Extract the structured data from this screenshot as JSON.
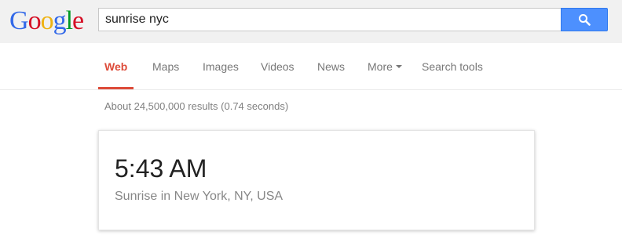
{
  "logo": {
    "letters": [
      "G",
      "o",
      "o",
      "g",
      "l",
      "e"
    ],
    "colors": [
      "#3369e8",
      "#d50f25",
      "#eeb211",
      "#3369e8",
      "#009925",
      "#d50f25"
    ]
  },
  "search": {
    "query": "sunrise nyc",
    "button_icon": "search-icon",
    "button_color": "#4d90fe"
  },
  "nav": {
    "tabs": [
      {
        "label": "Web",
        "active": true
      },
      {
        "label": "Maps",
        "active": false
      },
      {
        "label": "Images",
        "active": false
      },
      {
        "label": "Videos",
        "active": false
      },
      {
        "label": "News",
        "active": false
      },
      {
        "label": "More",
        "active": false,
        "icon": "caret-down-icon"
      },
      {
        "label": "Search tools",
        "active": false
      }
    ],
    "active_color": "#dd4b39"
  },
  "results": {
    "stats": "About 24,500,000 results (0.74 seconds)"
  },
  "answer": {
    "time": "5:43 AM",
    "description": "Sunrise in New York, NY, USA"
  }
}
